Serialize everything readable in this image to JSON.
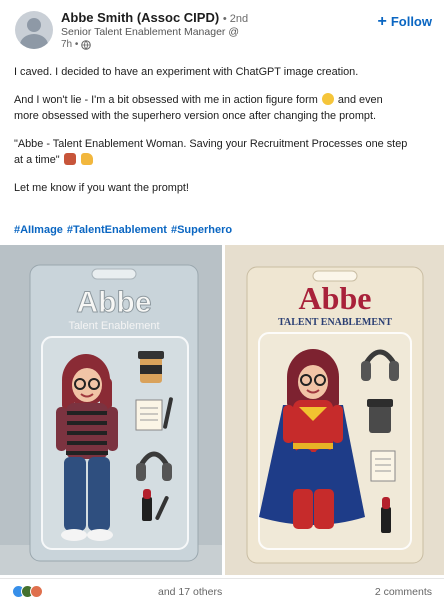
{
  "post": {
    "author": {
      "name": "Abbe Smith (Assoc CIPD)",
      "degree": "• 2nd",
      "headline": "Senior Talent Enablement Manager @",
      "time": "7h •"
    },
    "follow_label": "Follow",
    "body": {
      "line1": "I caved. I decided to have an experiment with ChatGPT image creation.",
      "line2a": "And I won't lie - I'm a bit obsessed with me in action figure form",
      "line2b": "and even",
      "line3": "more obsessed with the superhero version once after changing the prompt.",
      "line4": "\"Abbe - Talent Enablement Woman. Saving your Recruitment Processes one step",
      "line5": "at a time\"",
      "line6": "Let me know if you want the prompt!"
    },
    "hashtags": [
      "#AIImage",
      "#TalentEnablement",
      "#Superhero"
    ],
    "images": {
      "left": {
        "title": "Abbe",
        "subtitle": "Talent Enablement"
      },
      "right": {
        "title": "Abbe",
        "subtitle": "TALENT ENABLEMENT"
      }
    },
    "social": {
      "others": "and 17 others",
      "comments": "2 comments"
    }
  },
  "colors": {
    "link": "#0a66c2",
    "left_bg": "#b9c2c7",
    "right_bg": "#e7dfcf",
    "title_right": "#a8213a"
  }
}
